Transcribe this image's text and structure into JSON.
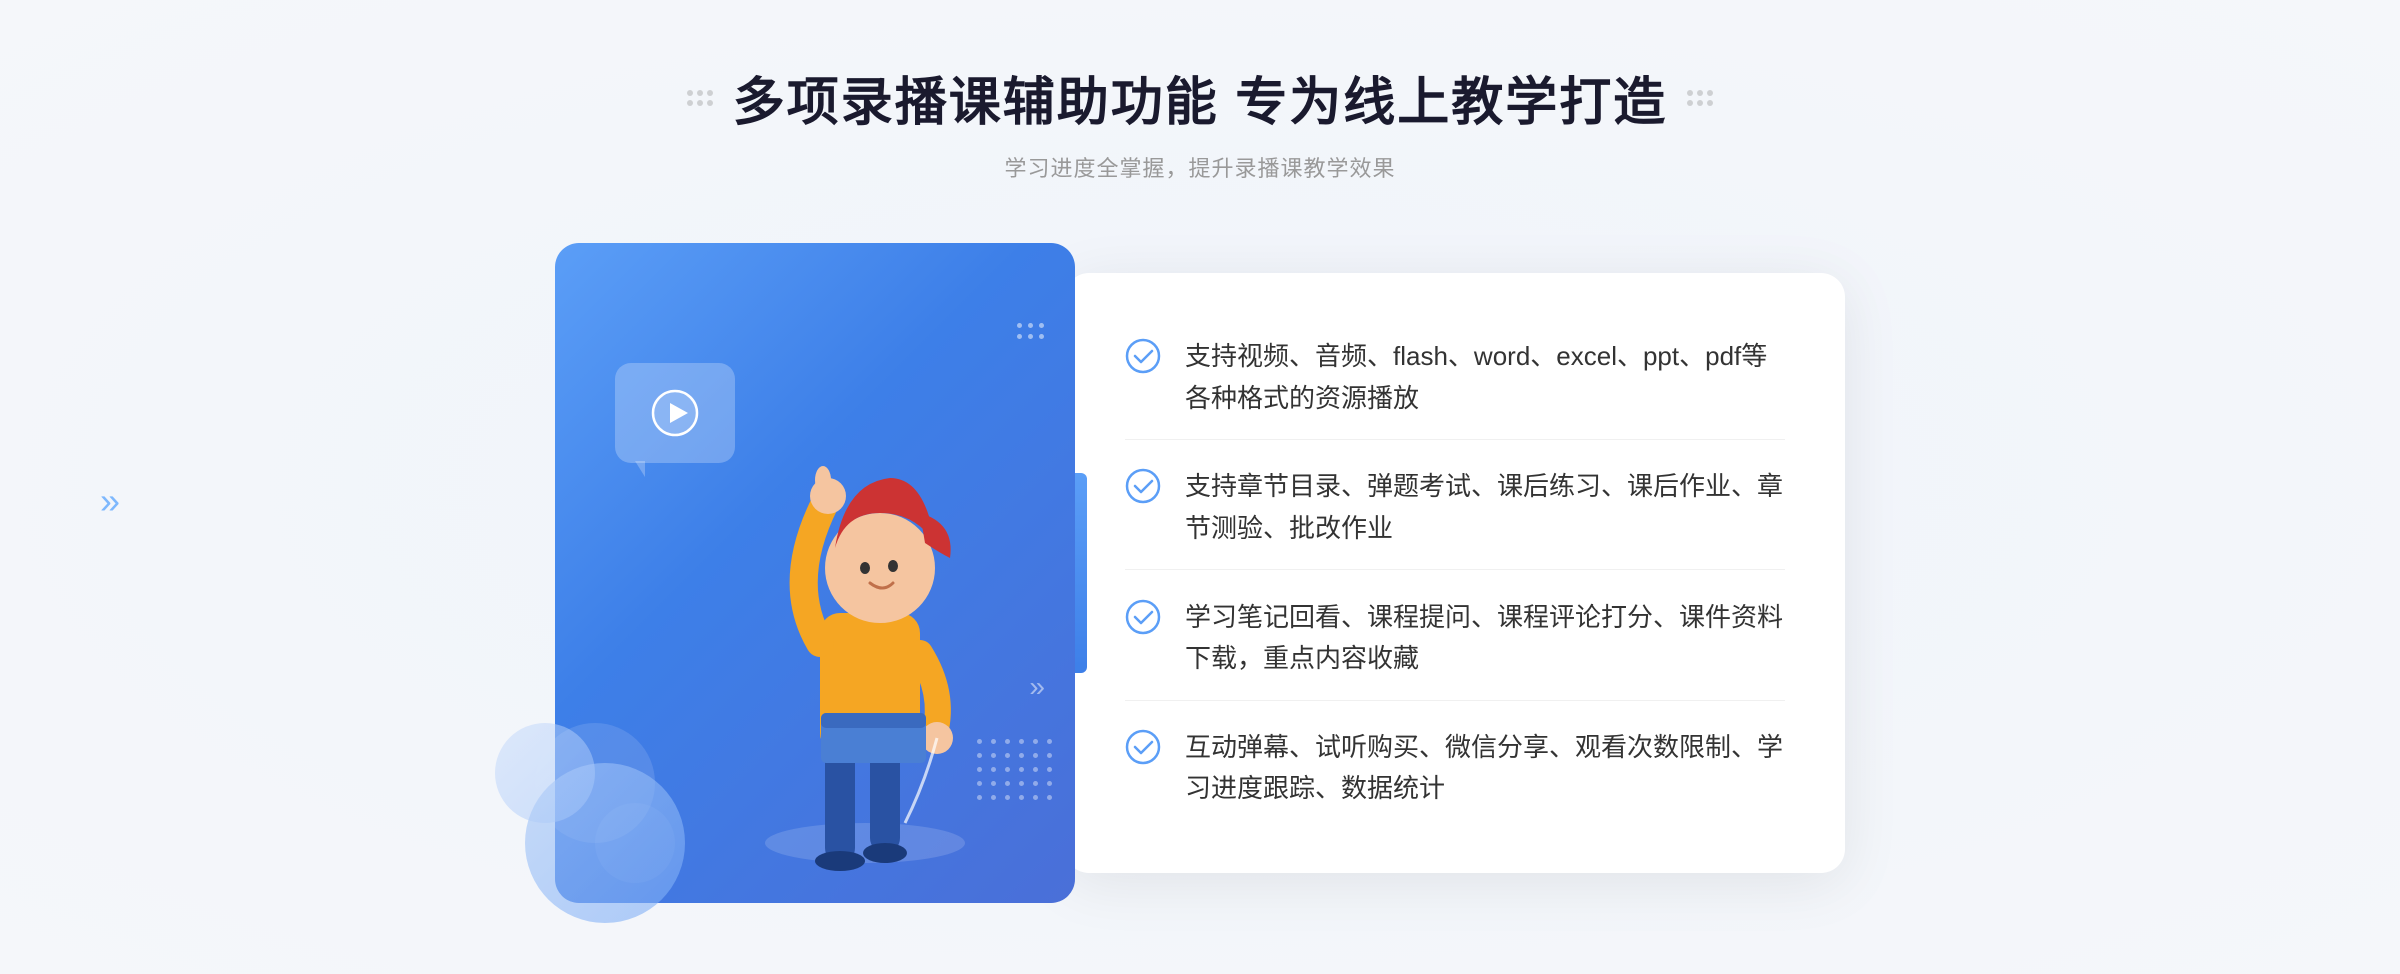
{
  "header": {
    "title": "多项录播课辅助功能 专为线上教学打造",
    "subtitle": "学习进度全掌握，提升录播课教学效果"
  },
  "features": [
    {
      "id": "feature-1",
      "text": "支持视频、音频、flash、word、excel、ppt、pdf等各种格式的资源播放"
    },
    {
      "id": "feature-2",
      "text": "支持章节目录、弹题考试、课后练习、课后作业、章节测验、批改作业"
    },
    {
      "id": "feature-3",
      "text": "学习笔记回看、课程提问、课程评论打分、课件资料下载，重点内容收藏"
    },
    {
      "id": "feature-4",
      "text": "互动弹幕、试听购买、微信分享、观看次数限制、学习进度跟踪、数据统计"
    }
  ],
  "colors": {
    "primary": "#3d7fe8",
    "secondary": "#5b9ef7",
    "accent": "#4a6fd8"
  }
}
